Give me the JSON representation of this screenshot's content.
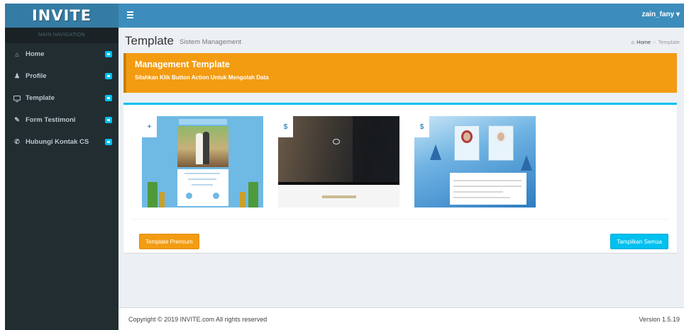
{
  "header": {
    "logo": "INVITE",
    "user": "zain_fany",
    "user_caret": "▾"
  },
  "sidebar": {
    "section_title": "MAIN NAVIGATION",
    "items": [
      {
        "label": "Home",
        "icon": "home-icon"
      },
      {
        "label": "Profile",
        "icon": "user-icon"
      },
      {
        "label": "Template",
        "icon": "monitor-icon"
      },
      {
        "label": "Form Testimoni",
        "icon": "edit-icon"
      },
      {
        "label": "Hubungi Kontak CS",
        "icon": "phone-icon"
      }
    ]
  },
  "content_header": {
    "title": "Template",
    "subtitle": "Sistem Management",
    "breadcrumb_home": "Home",
    "breadcrumb_current": "Template"
  },
  "callout": {
    "title": "Management Template",
    "text": "Silahkan Klik Button Action Untuk Mengolah Data"
  },
  "templates": [
    {
      "badge": "+",
      "theme": "blue"
    },
    {
      "badge": "$",
      "theme": "dark"
    },
    {
      "badge": "$",
      "theme": "winter"
    }
  ],
  "buttons": {
    "premium": "Template Premium",
    "show_all": "Tampilkan Semua"
  },
  "footer": {
    "copyright": "Copyright © 2019 INVITE.com All rights reserved",
    "version": "Version 1.5.19"
  },
  "colors": {
    "topbar": "#3c8dbc",
    "logo_bg": "#357ca5",
    "sidebar": "#222d32",
    "accent_orange": "#f39c12",
    "accent_cyan": "#00c0ef"
  }
}
